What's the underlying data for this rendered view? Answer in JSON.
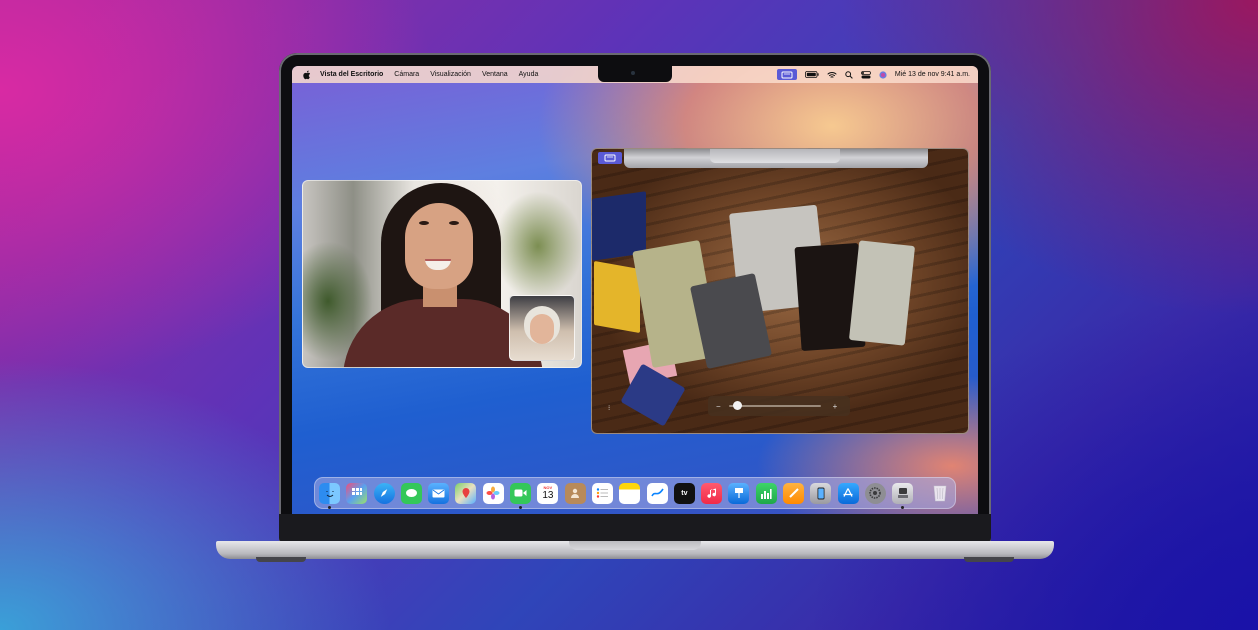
{
  "menubar": {
    "app_name": "Vista del Escritorio",
    "menus": [
      "Cámara",
      "Visualización",
      "Ventana",
      "Ayuda"
    ],
    "date_time": "Mié 13 de nov  9:41 a.m."
  },
  "deskview": {
    "zoom_minus": "−",
    "zoom_plus": "+",
    "zoom_level": 0.05
  },
  "dock": {
    "calendar_day": "13",
    "calendar_month": "NOV",
    "apps": [
      "Finder",
      "Launchpad",
      "Safari",
      "Mensajes",
      "Mail",
      "Mapas",
      "Fotos",
      "FaceTime",
      "Calendario",
      "Contactos",
      "Recordatorios",
      "Notas",
      "Freeform",
      "TV",
      "Música",
      "Keynote",
      "Numbers",
      "Pages",
      "iPhone Mirroring",
      "App Store",
      "Configuración",
      "Vista del Escritorio",
      "Papelera"
    ]
  },
  "colors": {
    "accent": "#5a5ad6",
    "menubar": "#fadccd",
    "background": "#5d33b8"
  }
}
